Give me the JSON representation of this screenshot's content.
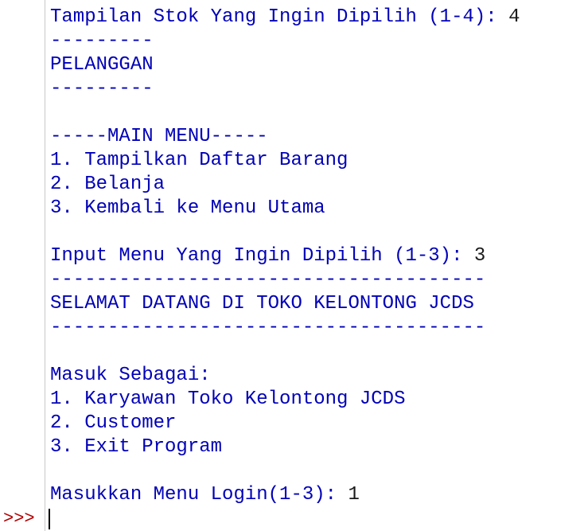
{
  "console": {
    "lines": [
      {
        "text": "Tampilan Stok Yang Ingin Dipilih (1-4): ",
        "input": "4"
      },
      {
        "text": "---------"
      },
      {
        "text": "PELANGGAN"
      },
      {
        "text": "---------"
      },
      {
        "text": ""
      },
      {
        "text": "-----MAIN MENU-----"
      },
      {
        "text": "1. Tampilkan Daftar Barang"
      },
      {
        "text": "2. Belanja"
      },
      {
        "text": "3. Kembali ke Menu Utama"
      },
      {
        "text": ""
      },
      {
        "text": "Input Menu Yang Ingin Dipilih (1-3): ",
        "input": "3"
      },
      {
        "text": "--------------------------------------"
      },
      {
        "text": "SELAMAT DATANG DI TOKO KELONTONG JCDS"
      },
      {
        "text": "--------------------------------------"
      },
      {
        "text": ""
      },
      {
        "text": "Masuk Sebagai:"
      },
      {
        "text": "1. Karyawan Toko Kelontong JCDS"
      },
      {
        "text": "2. Customer"
      },
      {
        "text": "3. Exit Program"
      },
      {
        "text": ""
      },
      {
        "text": "Masukkan Menu Login(1-3): ",
        "input": "1"
      }
    ],
    "prompt_marker": ">>>"
  },
  "colors": {
    "output_text": "#0000b8",
    "user_input": "#1a1a1a",
    "prompt_marker": "#b00000",
    "gutter_line": "#c8c8c8"
  }
}
